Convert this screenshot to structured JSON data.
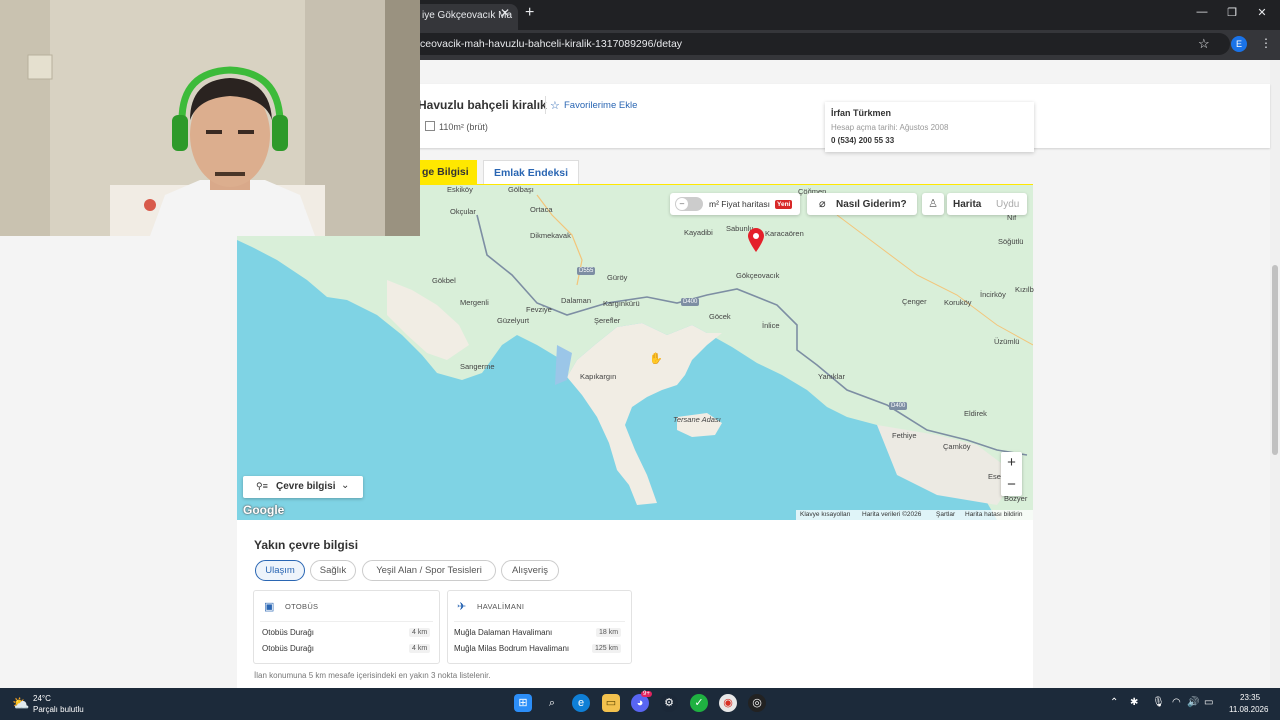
{
  "browser": {
    "tab_title": "iye Gökçeovacık Ma",
    "tab_close": "✕",
    "new_tab": "+",
    "url": "ceovacik-mah-havuzlu-bahceli-kiralik-1317089296/detay",
    "profile_letter": "E",
    "window_controls": [
      "—",
      "❐",
      "✕"
    ]
  },
  "listing": {
    "title": "Havuzlu bahçeli kiralık",
    "favorite_label": "Favorilerime Ekle",
    "area": "110m² (brüt)"
  },
  "seller": {
    "name": "İrfan Türkmen",
    "since": "Hesap açma tarihi: Ağustos 2008",
    "phone": "0 (534) 200 55 33"
  },
  "tabs": {
    "active": "ge Bilgisi",
    "index": "Emlak Endeksi"
  },
  "map": {
    "price_map_label": "m² Fiyat haritası",
    "new_badge": "Yeni",
    "directions_label": "Nasıl Giderim?",
    "type_map": "Harita",
    "type_satellite": "Uydu",
    "zoom_in": "+",
    "zoom_out": "−",
    "environment_label": "Çevre bilgisi",
    "logo": "Google",
    "attribution": [
      "Klavye kısayolları",
      "Harita verileri ©2026",
      "Şartlar",
      "Harita hatası bildirin"
    ],
    "labels": [
      "Eskiköy",
      "Gölbaşı",
      "Okçular",
      "Ortaca",
      "Dikmekavak",
      "Gökbel",
      "Mergenli",
      "Fevziye",
      "Dalaman",
      "Güzelyurt",
      "Şerefler",
      "Kargınkürü",
      "Güröy",
      "Sangerme",
      "Kapıkargın",
      "Tersane Adası",
      "Kayadibi",
      "Sabunlu",
      "Karacaören",
      "Gökçeovacık",
      "Göcek",
      "İnlice",
      "Yanıklar",
      "Fethiye",
      "Eldirek",
      "Çamköy",
      "Çenger",
      "Koruköy",
      "İncirköy",
      "Üzümlü",
      "Söğütlü",
      "Kızılb",
      "Çöğmen",
      "Nif",
      "Ese",
      "Bozyer"
    ],
    "roads": [
      "D555",
      "D400",
      "D400"
    ]
  },
  "nearby": {
    "title": "Yakın çevre bilgisi",
    "chips": [
      "Ulaşım",
      "Sağlık",
      "Yeşil Alan / Spor Tesisleri",
      "Alışveriş"
    ],
    "bus": {
      "header": "OTOBÜS",
      "items": [
        {
          "name": "Otobüs Durağı",
          "distance": "4 km"
        },
        {
          "name": "Otobüs Durağı",
          "distance": "4 km"
        }
      ]
    },
    "airport": {
      "header": "HAVALİMANI",
      "items": [
        {
          "name": "Muğla Dalaman Havalimanı",
          "distance": "18 km"
        },
        {
          "name": "Muğla Milas Bodrum Havalimanı",
          "distance": "125 km"
        }
      ]
    },
    "note": "İlan konumuna 5 km mesafe içerisindeki en yakın 3 nokta listelenir."
  },
  "taskbar": {
    "temperature": "24°C",
    "weather": "Parçalı bulutlu",
    "time": "23:35",
    "date": "11.08.2026",
    "discord_badge": "9+"
  },
  "colors": {
    "accent_yellow": "#ffe800",
    "link_blue": "#2a66b3",
    "pin_red": "#e4202a",
    "sea": "#7fd3e4",
    "land": "#d9efd9"
  }
}
